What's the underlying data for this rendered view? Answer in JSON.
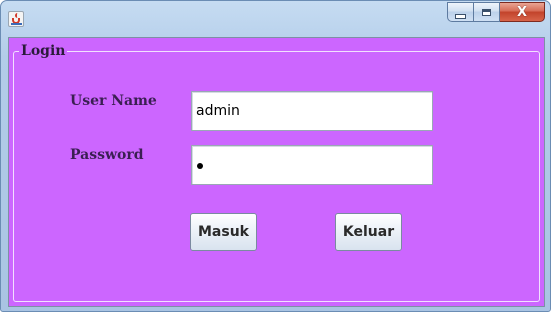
{
  "window": {
    "icon": "java-cup-icon",
    "controls": {
      "minimize": "minimize-icon",
      "maximize": "maximize-icon",
      "close": "close-icon",
      "close_glyph": "X"
    }
  },
  "login": {
    "group_title": "Login",
    "username_label": "User Name",
    "username_value": "admin",
    "password_label": "Password",
    "password_masked": "•",
    "submit_label": "Masuk",
    "exit_label": "Keluar"
  },
  "colors": {
    "panel": "#cc66ff",
    "title_bar": "#b3cde9",
    "close_button": "#c2432b"
  }
}
